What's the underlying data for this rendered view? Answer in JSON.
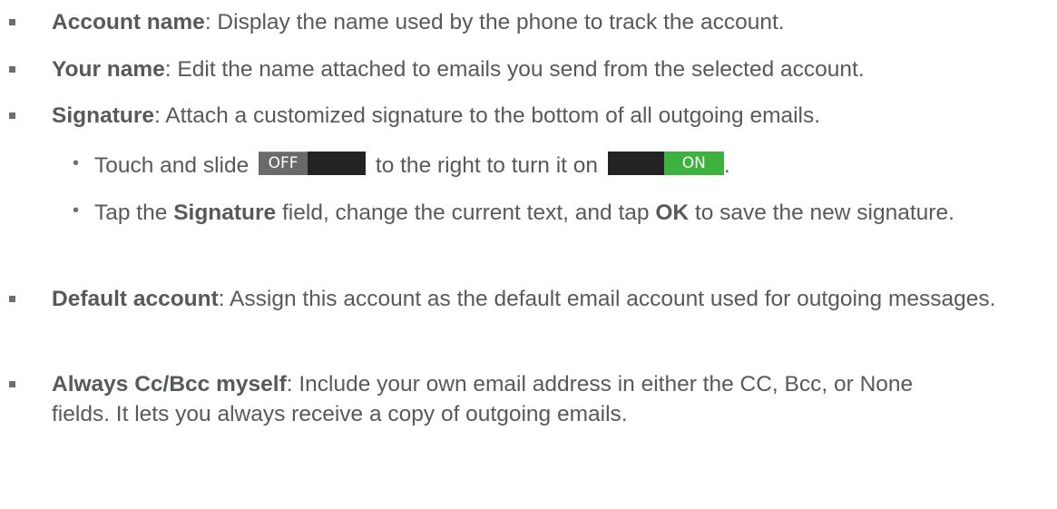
{
  "items": [
    {
      "term": "Account name",
      "desc": ": Display the name used by the phone to track the account."
    },
    {
      "term": "Your name",
      "desc": ": Edit the name attached to emails you send from the selected account."
    },
    {
      "term": "Signature",
      "desc": ": Attach a customized signature to the bottom of all outgoing emails."
    }
  ],
  "sub_items": {
    "slide": {
      "before": "Touch and slide",
      "off_label": "OFF",
      "middle": "to the right to turn it on",
      "on_label": "ON",
      "after": "."
    },
    "tap": {
      "p1": "Tap the ",
      "b1": "Signature",
      "p2": " field, change the current text, and tap ",
      "b2": "OK",
      "p3": " to save the new signature."
    }
  },
  "items2": [
    {
      "term": "Default account",
      "desc": ": Assign this account as the default email account used for outgoing messages."
    },
    {
      "term": "Always Cc/Bcc myself",
      "desc": ": Include your own email address in either the CC, Bcc, or None fields. It lets you always receive a copy of outgoing emails."
    }
  ],
  "colors": {
    "text": "#58595b",
    "toggle_on": "#3eb23e",
    "toggle_off": "#6a6a6a",
    "toggle_track": "#232323"
  }
}
